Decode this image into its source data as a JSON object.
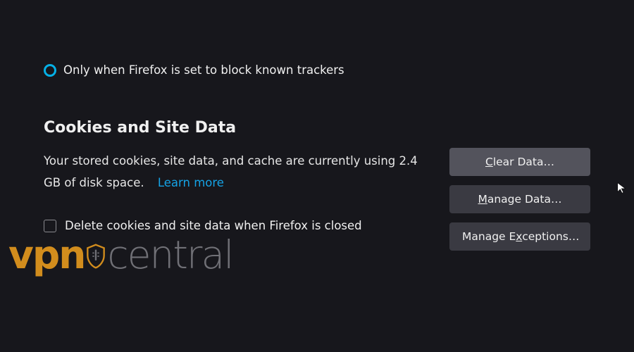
{
  "tracking_option": {
    "label": "Only when Firefox is set to block known trackers"
  },
  "cookies_section": {
    "heading": "Cookies and Site Data",
    "description_prefix": "Your stored cookies, site data, and cache are currently using ",
    "storage_used": "2.4 GB",
    "description_suffix": " of disk space.",
    "learn_more": "Learn more",
    "delete_on_close_label": "Delete cookies and site data when Firefox is closed",
    "buttons": {
      "clear": {
        "prefix": "",
        "accesskey": "C",
        "rest": "lear Data…"
      },
      "manage": {
        "prefix": "",
        "accesskey": "M",
        "rest": "anage Data…"
      },
      "exceptions": {
        "prefix": "Manage E",
        "accesskey": "x",
        "rest": "ceptions…"
      }
    }
  },
  "watermark": {
    "vpn": "vpn",
    "central": "central"
  }
}
